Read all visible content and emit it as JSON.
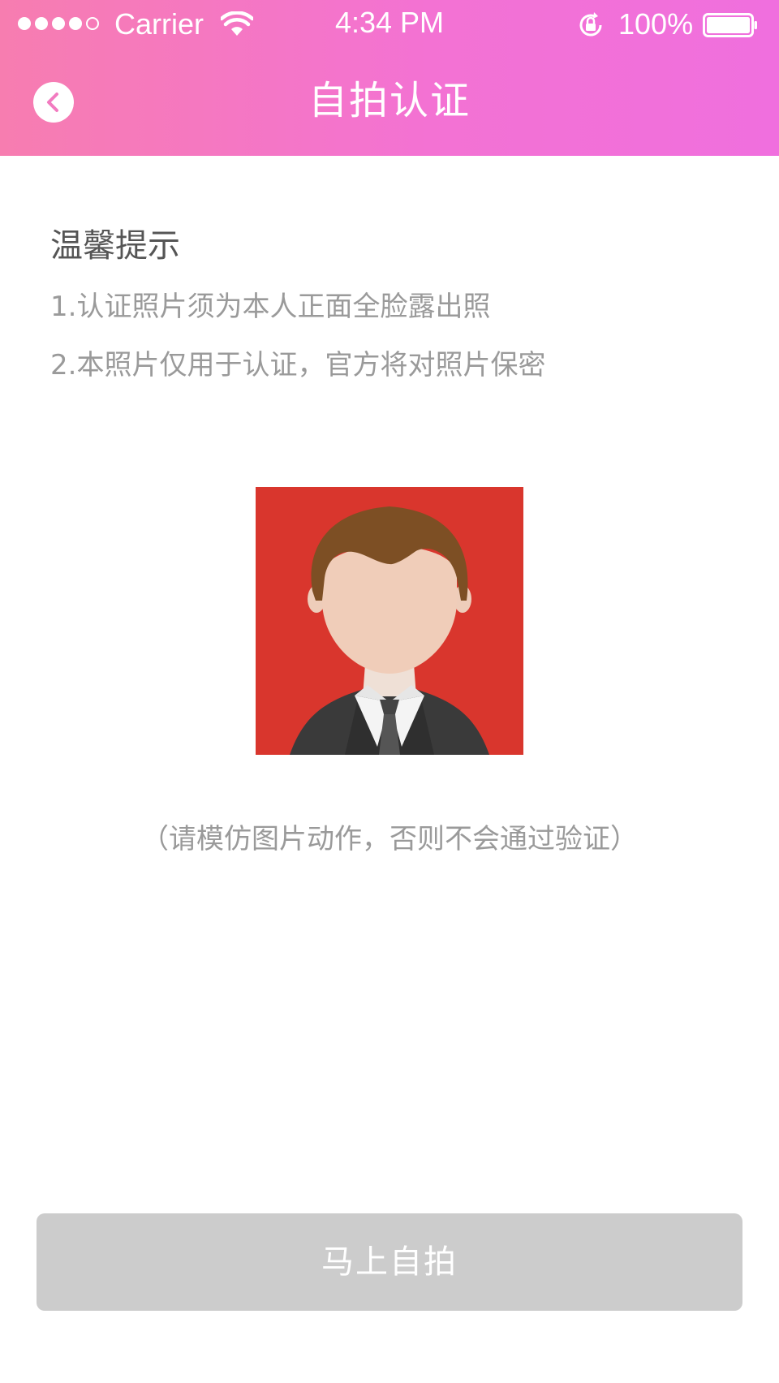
{
  "status_bar": {
    "carrier": "Carrier",
    "time": "4:34 PM",
    "battery_percent": "100%",
    "signal_bars_filled": 4,
    "signal_bars_total": 5
  },
  "nav": {
    "title": "自拍认证",
    "back_icon": "chevron-left-icon"
  },
  "tips": {
    "title": "温馨提示",
    "items": [
      "1.认证照片须为本人正面全脸露出照",
      "2.本照片仅用于认证，官方将对照片保密"
    ]
  },
  "sample": {
    "icon": "sample-selfie-avatar"
  },
  "hint": "（请模仿图片动作，否则不会通过验证）",
  "action": {
    "selfie_label": "马上自拍"
  },
  "colors": {
    "header_gradient_start": "#f77db0",
    "header_gradient_end": "#f06fde",
    "photo_background": "#d9362d",
    "button_disabled": "#cccccc"
  }
}
